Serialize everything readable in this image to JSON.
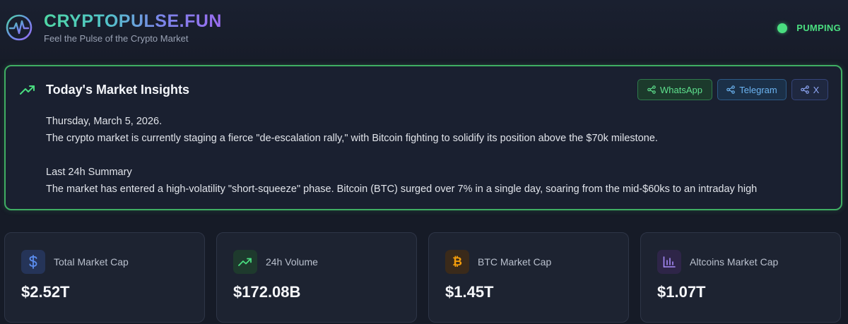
{
  "header": {
    "brand": "CRYPTOPULSE.FUN",
    "tagline": "Feel the Pulse of the Crypto Market",
    "status": "PUMPING"
  },
  "insights": {
    "title": "Today's Market Insights",
    "share": {
      "whatsapp": "WhatsApp",
      "telegram": "Telegram",
      "x": "X"
    },
    "date": "Thursday, March 5, 2026.",
    "intro": "The crypto market is currently staging a fierce \"de-escalation rally,\" with Bitcoin fighting to solidify its position above the $70k milestone.",
    "summary_heading": "Last 24h Summary",
    "summary_text": "The market has entered a high-volatility \"short-squeeze\" phase. Bitcoin (BTC) surged over 7% in a single day, soaring from the mid-$60ks to an intraday high"
  },
  "stats": [
    {
      "label": "Total Market Cap",
      "value": "$2.52T",
      "icon": "dollar-icon",
      "color": "#5b8def"
    },
    {
      "label": "24h Volume",
      "value": "$172.08B",
      "icon": "trend-up-icon",
      "color": "#4ade80"
    },
    {
      "label": "BTC Market Cap",
      "value": "$1.45T",
      "icon": "bitcoin-icon",
      "color": "#f59e0b"
    },
    {
      "label": "Altcoins Market Cap",
      "value": "$1.07T",
      "icon": "bar-chart-icon",
      "color": "#a78bfa"
    }
  ],
  "colors": {
    "accent_green": "#4ade80",
    "background": "#161b27",
    "card": "#1d2331"
  }
}
